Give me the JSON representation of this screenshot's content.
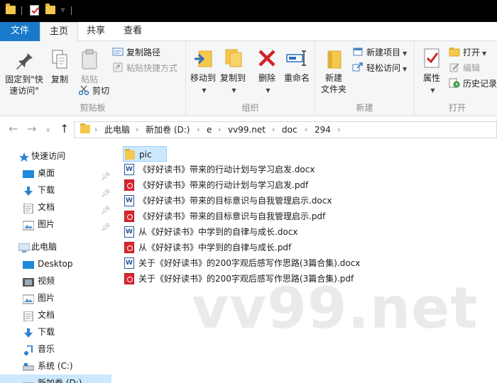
{
  "ribbon_tabs": {
    "file": "文件",
    "home": "主页",
    "share": "共享",
    "view": "查看"
  },
  "clipboard": {
    "pin_line1": "固定到\"快",
    "pin_line2": "速访问\"",
    "copy": "复制",
    "paste": "粘贴",
    "copy_path": "复制路径",
    "paste_shortcut": "粘贴快捷方式",
    "cut": "剪切",
    "label": "剪贴板"
  },
  "organize": {
    "move_to": "移动到",
    "copy_to": "复制到",
    "delete": "删除",
    "rename": "重命名",
    "label": "组织"
  },
  "new_group": {
    "new_folder_line1": "新建",
    "new_folder_line2": "文件夹",
    "new_item": "新建项目",
    "easy_access": "轻松访问",
    "label": "新建"
  },
  "open_group": {
    "properties": "属性",
    "open": "打开",
    "edit": "编辑",
    "history": "历史记录",
    "label": "打开"
  },
  "address": {
    "crumbs": [
      "此电脑",
      "新加卷 (D:)",
      "e",
      "vv99.net",
      "doc",
      "294"
    ]
  },
  "nav": {
    "quick_access": "快速访问",
    "desktop": "桌面",
    "downloads": "下载",
    "documents": "文档",
    "pictures": "图片",
    "this_pc": "此电脑",
    "pc_desktop": "Desktop",
    "videos": "视频",
    "pc_pictures": "图片",
    "pc_documents": "文档",
    "pc_downloads": "下载",
    "music": "音乐",
    "system_c": "系统 (C:)",
    "new_volume_d": "新加卷 (D:)"
  },
  "files": [
    {
      "name": "pic",
      "type": "folder"
    },
    {
      "name": "《好好读书》带来的行动计划与学习启发.docx",
      "type": "docx"
    },
    {
      "name": "《好好读书》带来的行动计划与学习启发.pdf",
      "type": "pdf"
    },
    {
      "name": "《好好读书》带来的目标意识与自我管理启示.docx",
      "type": "docx"
    },
    {
      "name": "《好好读书》带来的目标意识与自我管理启示.pdf",
      "type": "pdf"
    },
    {
      "name": "从《好好读书》中学到的自律与成长.docx",
      "type": "docx"
    },
    {
      "name": "从《好好读书》中学到的自律与成长.pdf",
      "type": "pdf"
    },
    {
      "name": "关于《好好读书》的200字观后感写作思路(3篇合集).docx",
      "type": "docx"
    },
    {
      "name": "关于《好好读书》的200字观后感写作思路(3篇合集).pdf",
      "type": "pdf"
    }
  ],
  "watermark": "vv99.net",
  "colors": {
    "accent": "#1979ca",
    "selection": "#cce8ff",
    "folder": "#f5c84b",
    "word": "#2b579a",
    "pdf": "#d9262e",
    "delete": "#d0232a"
  }
}
